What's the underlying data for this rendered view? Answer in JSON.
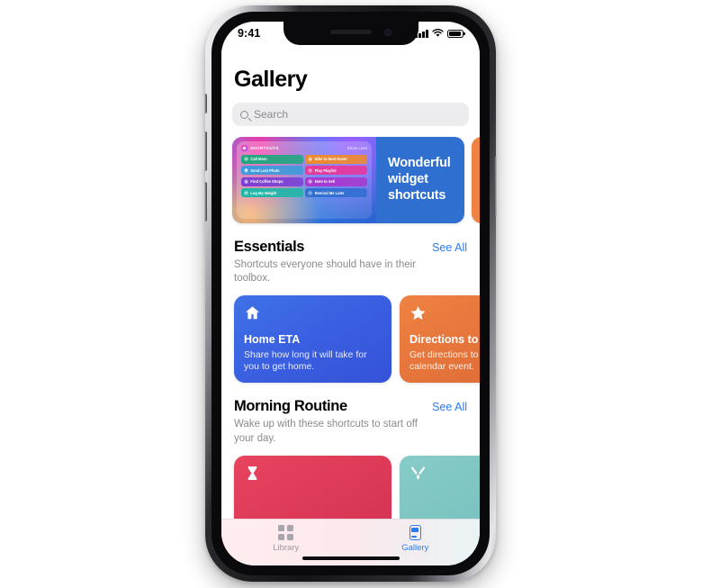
{
  "device": {
    "name": "iphone-x"
  },
  "status_bar": {
    "time": "9:41",
    "icons": [
      "cellular-signal-icon",
      "wifi-icon",
      "battery-icon"
    ]
  },
  "app": {
    "title": "Gallery",
    "search": {
      "placeholder": "Search",
      "value": ""
    }
  },
  "featured": {
    "cards": [
      {
        "headline": "Wonderful widget shortcuts",
        "widget": {
          "app_label": "SHORTCUTS",
          "action_label": "Show Less",
          "tiles": [
            {
              "label": "Call Mom",
              "icon": "phone-icon",
              "color": "#1fa87e"
            },
            {
              "label": "Bike to Next Event",
              "icon": "location-icon",
              "color": "#f08a2a"
            },
            {
              "label": "Send Last Photo",
              "icon": "camera-icon",
              "color": "#3b9bdb"
            },
            {
              "label": "Play Playlist",
              "icon": "music-icon",
              "color": "#e8379a"
            },
            {
              "label": "Find Coffee Shops",
              "icon": "book-icon",
              "color": "#7b3fd4"
            },
            {
              "label": "Note to Self",
              "icon": "mail-icon",
              "color": "#a838cf"
            },
            {
              "label": "Log My Weight",
              "icon": "scale-icon",
              "color": "#1fb6a8"
            },
            {
              "label": "Remind Me Later",
              "icon": "clock-icon",
              "color": "#2f6fd0"
            }
          ]
        }
      }
    ]
  },
  "sections": [
    {
      "title": "Essentials",
      "see_all": "See All",
      "subtitle": "Shortcuts everyone should have in their toolbox.",
      "cards": [
        {
          "name": "Home ETA",
          "description": "Share how long it will take for you to get home.",
          "icon": "house-icon",
          "theme": "c-blue"
        },
        {
          "name": "Directions to Event",
          "description": "Get directions to your next calendar event.",
          "icon": "star-icon",
          "theme": "c-orange"
        }
      ]
    },
    {
      "title": "Morning Routine",
      "see_all": "See All",
      "subtitle": "Wake up with these shortcuts to start off your day.",
      "cards": [
        {
          "name": "",
          "description": "",
          "icon": "hourglass-icon",
          "theme": "c-red"
        },
        {
          "name": "",
          "description": "",
          "icon": "cutlery-icon",
          "theme": "c-teal"
        }
      ]
    }
  ],
  "tab_bar": {
    "tabs": [
      {
        "label": "Library",
        "icon": "grid-squares-icon",
        "active": false
      },
      {
        "label": "Gallery",
        "icon": "card-stack-icon",
        "active": true
      }
    ]
  },
  "colors": {
    "accent_blue": "#2b7cf0",
    "title_black": "#000000",
    "subtitle_gray": "#8a8a8f",
    "search_bg": "#ececee"
  }
}
